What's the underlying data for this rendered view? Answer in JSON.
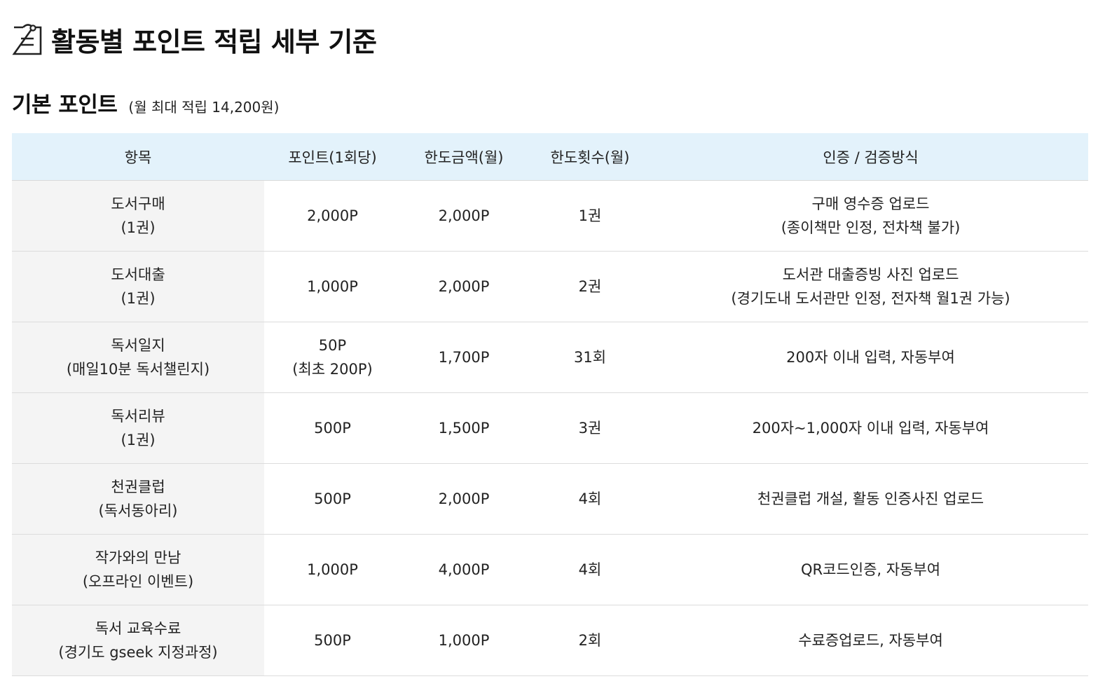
{
  "page": {
    "title": "활동별 포인트 적립 세부 기준",
    "title_icon": "clipboard-icon"
  },
  "section": {
    "title": "기본 포인트",
    "note": "(월 최대 적립 14,200원)"
  },
  "table": {
    "headers": [
      "항목",
      "포인트(1회당)",
      "한도금액(월)",
      "한도횟수(월)",
      "인증 / 검증방식"
    ],
    "rows": [
      {
        "item": [
          "도서구매",
          "(1권)"
        ],
        "points": [
          "2,000P"
        ],
        "limit_amount": "2,000P",
        "limit_count": "1권",
        "verification": [
          "구매 영수증 업로드",
          "(종이책만 인정, 전차책 불가)"
        ]
      },
      {
        "item": [
          "도서대출",
          "(1권)"
        ],
        "points": [
          "1,000P"
        ],
        "limit_amount": "2,000P",
        "limit_count": "2권",
        "verification": [
          "도서관 대출증빙 사진 업로드",
          "(경기도내 도서관만 인정, 전자책 월1권 가능)"
        ]
      },
      {
        "item": [
          "독서일지",
          "(매일10분 독서챌린지)"
        ],
        "points": [
          "50P",
          "(최초 200P)"
        ],
        "limit_amount": "1,700P",
        "limit_count": "31회",
        "verification": [
          "200자 이내 입력, 자동부여"
        ]
      },
      {
        "item": [
          "독서리뷰",
          "(1권)"
        ],
        "points": [
          "500P"
        ],
        "limit_amount": "1,500P",
        "limit_count": "3권",
        "verification": [
          "200자~1,000자 이내 입력, 자동부여"
        ]
      },
      {
        "item": [
          "천권클럽",
          "(독서동아리)"
        ],
        "points": [
          "500P"
        ],
        "limit_amount": "2,000P",
        "limit_count": "4회",
        "verification": [
          "천권클럽 개설, 활동 인증사진 업로드"
        ]
      },
      {
        "item": [
          "작가와의 만남",
          "(오프라인 이벤트)"
        ],
        "points": [
          "1,000P"
        ],
        "limit_amount": "4,000P",
        "limit_count": "4회",
        "verification": [
          "QR코드인증, 자동부여"
        ]
      },
      {
        "item": [
          "독서 교육수료",
          "(경기도 gseek 지정과정)"
        ],
        "points": [
          "500P"
        ],
        "limit_amount": "1,000P",
        "limit_count": "2회",
        "verification": [
          "수료증업로드, 자동부여"
        ]
      }
    ]
  },
  "colors": {
    "header_bg": "#e3f2fb",
    "item_cell_bg": "#f4f4f4",
    "row_border": "#dcdcdc",
    "text": "#222222"
  }
}
